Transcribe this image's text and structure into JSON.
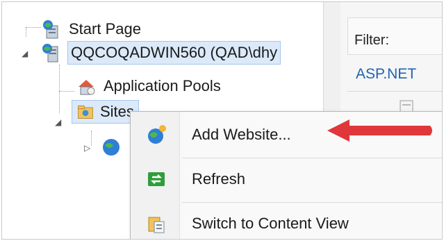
{
  "tree": {
    "nodes": [
      {
        "label": "Start Page"
      },
      {
        "label": "QQCOQADWIN560 (QAD\\dhy"
      },
      {
        "label": "Application Pools"
      },
      {
        "label": "Sites"
      }
    ]
  },
  "right_pane": {
    "filter_label": "Filter:",
    "aspnet_label": "ASP.NET"
  },
  "context_menu": {
    "items": [
      {
        "label": "Add Website...",
        "icon": "add-website-globe-icon"
      },
      {
        "label": "Refresh",
        "icon": "refresh-icon"
      },
      {
        "label": "Switch to Content View",
        "icon": "content-view-icon"
      }
    ]
  },
  "annotation": {
    "arrow_color": "#e0373a"
  }
}
